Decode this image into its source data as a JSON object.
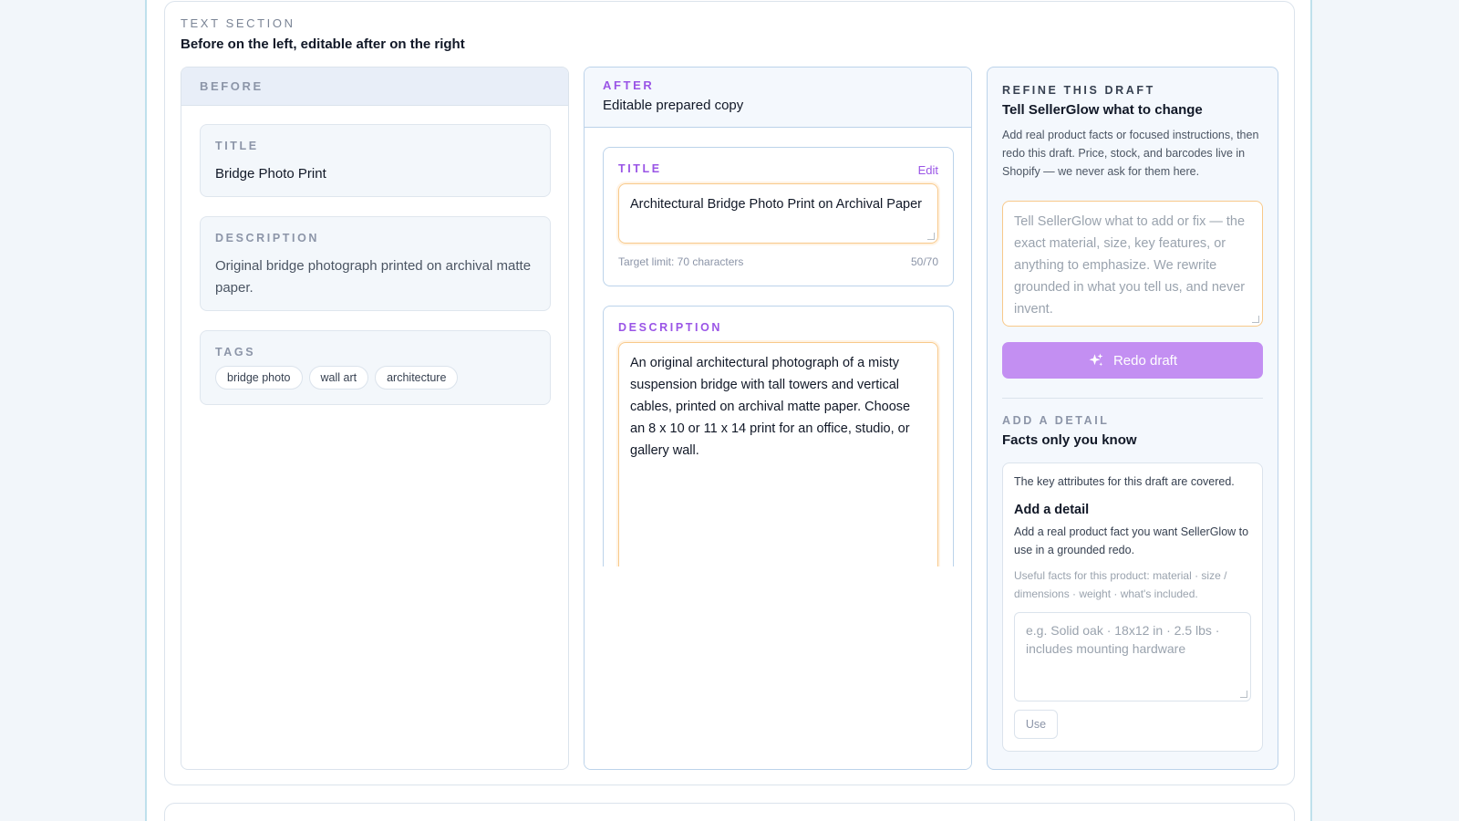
{
  "section": {
    "eyebrow": "TEXT SECTION",
    "title": "Before on the left, editable after on the right"
  },
  "before": {
    "eyebrow": "BEFORE",
    "title_label": "TITLE",
    "title_value": "Bridge Photo Print",
    "description_label": "DESCRIPTION",
    "description_value": "Original bridge photograph printed on archival matte paper.",
    "tags_label": "TAGS",
    "tags": [
      "bridge photo",
      "wall art",
      "architecture"
    ]
  },
  "after": {
    "eyebrow": "AFTER",
    "subtitle": "Editable prepared copy",
    "title_label": "TITLE",
    "edit_label": "Edit",
    "title_value": "Architectural Bridge Photo Print on Archival Paper",
    "title_limit": "Target limit: 70 characters",
    "title_count": "50/70",
    "description_label": "DESCRIPTION",
    "description_value": "An original architectural photograph of a misty suspension bridge with tall towers and vertical cables, printed on archival matte paper. Choose an 8 x 10 or 11 x 14 print for an office, studio, or gallery wall."
  },
  "refine": {
    "eyebrow": "REFINE THIS DRAFT",
    "title": "Tell SellerGlow what to change",
    "help": "Add real product facts or focused instructions, then redo this draft. Price, stock, and barcodes live in Shopify — we never ask for them here.",
    "input_placeholder": "Tell SellerGlow what to add or fix — the exact material, size, key features, or anything to emphasize. We rewrite grounded in what you tell us, and never invent.",
    "redo_label": "Redo draft",
    "redo_icon": "sparkle-icon"
  },
  "add_detail": {
    "eyebrow": "ADD A DETAIL",
    "title": "Facts only you know",
    "covered": "The key attributes for this draft are covered.",
    "card_title": "Add a detail",
    "card_help": "Add a real product fact you want SellerGlow to use in a grounded redo.",
    "hint": "Useful facts for this product: material · size / dimensions · weight · what's included.",
    "input_placeholder": "e.g. Solid oak · 18x12 in · 2.5 lbs · includes mounting hardware",
    "use_label": "Use"
  },
  "colors": {
    "accent_purple": "#9a55e6",
    "button_purple": "#c38ff2",
    "focus_orange": "#f8c98a",
    "border_blue": "#bcd3ea"
  }
}
